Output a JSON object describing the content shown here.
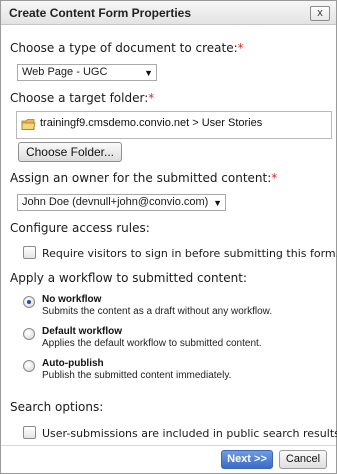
{
  "dialog": {
    "title": "Create Content Form Properties",
    "close_label": "x"
  },
  "doc_type": {
    "label": "Choose a type of document to create:",
    "required_mark": "*",
    "selected": "Web Page - UGC"
  },
  "target_folder": {
    "label": "Choose a target folder:",
    "required_mark": "*",
    "path": "trainingf9.cmsdemo.convio.net > User Stories",
    "button_label": "Choose Folder..."
  },
  "owner": {
    "label": "Assign an owner for the submitted content:",
    "required_mark": "*",
    "selected": "John Doe (devnull+john@convio.com)"
  },
  "access": {
    "label": "Configure access rules:",
    "checkbox_label": "Require visitors to sign in before submitting this form."
  },
  "workflow": {
    "label": "Apply a workflow to submitted content:",
    "options": [
      {
        "title": "No workflow",
        "desc": "Submits the content as a draft without any workflow.",
        "selected": true
      },
      {
        "title": "Default workflow",
        "desc": "Applies the default workflow to submitted content.",
        "selected": false
      },
      {
        "title": "Auto-publish",
        "desc": "Publish the submitted content immediately.",
        "selected": false
      }
    ]
  },
  "search": {
    "label": "Search options:",
    "checkbox_label": "User-submissions are included in public search results."
  },
  "footer": {
    "next_label": "Next >>",
    "cancel_label": "Cancel"
  },
  "colors": {
    "required": "#d62b2b",
    "primary_button": "#3a6cc6",
    "folder_icon": "#e8b84a"
  },
  "icons": {
    "folder": "folder-icon",
    "dropdown": "chevron-down-icon"
  }
}
